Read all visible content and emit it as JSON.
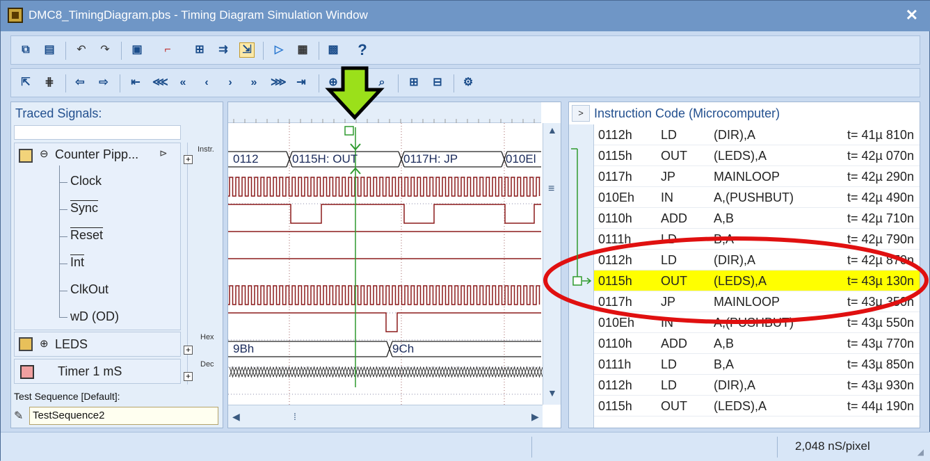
{
  "window": {
    "title": "DMC8_TimingDiagram.pbs - Timing Diagram Simulation Window",
    "close_glyph": "✕"
  },
  "toolbar1": {
    "buttons": [
      "copy-diagram-icon",
      "report-icon",
      "undo-icon",
      "redo-icon",
      "clipboard-icon",
      "step-icon",
      "zoom-fit-icon",
      "compare-icon",
      "select-signal-icon",
      "run-icon",
      "stop-icon",
      "grid-icon",
      "help-icon"
    ]
  },
  "toolbar2": {
    "buttons": [
      "pointer-icon",
      "bus-icon",
      "prev-edge-icon",
      "next-edge-icon",
      "first-icon",
      "fast-back-icon",
      "back-icon",
      "step-back-icon",
      "step-forward-icon",
      "forward-icon",
      "fast-forward-icon",
      "last-icon",
      "zoom-in-icon",
      "zoom-out-icon",
      "zoom-area-icon",
      "add-marker-icon",
      "delete-marker-icon",
      "settings-icon"
    ]
  },
  "traced": {
    "title": "Traced Signals:",
    "counter": "Counter Pipp...",
    "signals": [
      "Clock",
      "Sync",
      "Reset",
      "Int",
      "ClkOut",
      "wD (OD)"
    ],
    "leds": "LEDS",
    "timer": "Timer 1 mS",
    "fmt_instr": "Instr.",
    "fmt_hex": "Hex",
    "fmt_dec": "Dec",
    "test_seq_label": "Test Sequence [Default]:",
    "test_seq_value": "TestSequence2"
  },
  "waveform": {
    "instr_labels": [
      "0112",
      "0115H: OUT",
      "0117H: JP",
      "010El"
    ],
    "leds_labels": [
      "9Bh",
      "9Ch"
    ],
    "wave_color": "#8b1a1a",
    "marker_color": "#2e9a2e",
    "arrow_color": "#9be01a",
    "marker_glyph": "▽"
  },
  "instructions": {
    "header": "Instruction Code  (Microcomputer)",
    "header_button": ">",
    "rows": [
      {
        "addr": "0112h",
        "op": "LD",
        "arg": "(DIR),A",
        "t": "t= 41µ 810n"
      },
      {
        "addr": "0115h",
        "op": "OUT",
        "arg": "(LEDS),A",
        "t": "t= 42µ 070n"
      },
      {
        "addr": "0117h",
        "op": "JP",
        "arg": "MAINLOOP",
        "t": "t= 42µ 290n"
      },
      {
        "addr": "010Eh",
        "op": "IN",
        "arg": "A,(PUSHBUT)",
        "t": "t= 42µ 490n"
      },
      {
        "addr": "0110h",
        "op": "ADD",
        "arg": "A,B",
        "t": "t= 42µ 710n"
      },
      {
        "addr": "0111h",
        "op": "LD",
        "arg": "B,A",
        "t": "t= 42µ 790n"
      },
      {
        "addr": "0112h",
        "op": "LD",
        "arg": "(DIR),A",
        "t": "t= 42µ 870n"
      },
      {
        "addr": "0115h",
        "op": "OUT",
        "arg": "(LEDS),A",
        "t": "t= 43µ 130n"
      },
      {
        "addr": "0117h",
        "op": "JP",
        "arg": "MAINLOOP",
        "t": "t= 43µ 350n"
      },
      {
        "addr": "010Eh",
        "op": "IN",
        "arg": "A,(PUSHBUT)",
        "t": "t= 43µ 550n"
      },
      {
        "addr": "0110h",
        "op": "ADD",
        "arg": "A,B",
        "t": "t= 43µ 770n"
      },
      {
        "addr": "0111h",
        "op": "LD",
        "arg": "B,A",
        "t": "t= 43µ 850n"
      },
      {
        "addr": "0112h",
        "op": "LD",
        "arg": "(DIR),A",
        "t": "t= 43µ 930n"
      },
      {
        "addr": "0115h",
        "op": "OUT",
        "arg": "(LEDS),A",
        "t": "t= 44µ 190n"
      }
    ],
    "highlight_color": "#ffff00",
    "highlight_index": 7
  },
  "annotation": {
    "ellipse_color": "#e01010"
  },
  "status": {
    "scale": "2,048 nS/pixel"
  }
}
